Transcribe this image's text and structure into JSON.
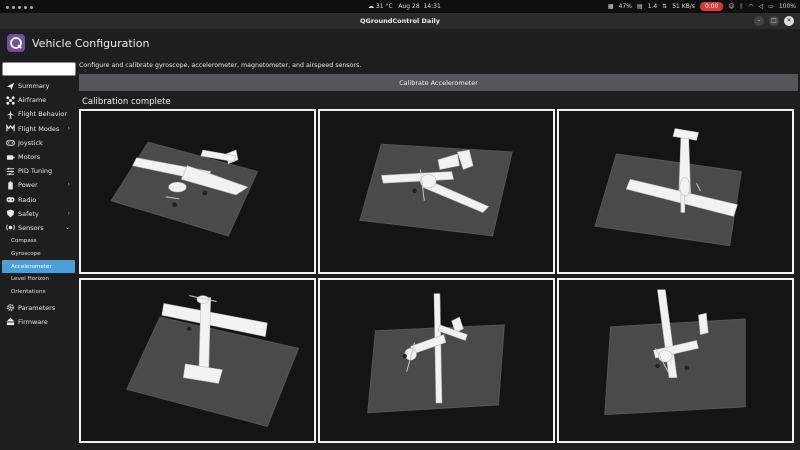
{
  "system_bar": {
    "temperature": "31 °C",
    "date": "Aug 28",
    "time": "14:31",
    "cpu": "47%",
    "load": "1.4",
    "network": "51 KB/s",
    "record": "0:00",
    "battery": "100%"
  },
  "window": {
    "title": "QGroundControl Daily"
  },
  "header": {
    "title": "Vehicle Configuration"
  },
  "sidebar": {
    "search_placeholder": "",
    "items": [
      {
        "label": "Summary",
        "icon": "send-icon"
      },
      {
        "label": "Airframe",
        "icon": "airframe-icon"
      },
      {
        "label": "Flight Behavior",
        "icon": "plane-icon"
      },
      {
        "label": "Flight Modes",
        "icon": "flight-modes-icon",
        "chevron": "›"
      },
      {
        "label": "Joystick",
        "icon": "joystick-icon"
      },
      {
        "label": "Motors",
        "icon": "motor-icon"
      },
      {
        "label": "PID Tuning",
        "icon": "tuning-icon"
      },
      {
        "label": "Power",
        "icon": "battery-icon",
        "chevron": "›"
      },
      {
        "label": "Radio",
        "icon": "radio-icon"
      },
      {
        "label": "Safety",
        "icon": "shield-icon",
        "chevron": "›"
      },
      {
        "label": "Sensors",
        "icon": "sensors-icon",
        "chevron": "⌄"
      },
      {
        "label": "Parameters",
        "icon": "gear-icon"
      },
      {
        "label": "Firmware",
        "icon": "firmware-icon"
      }
    ],
    "sensor_subitems": [
      "Compass",
      "Gyroscope",
      "Accelerometer",
      "Level Horizon",
      "Orientations"
    ],
    "active_subitem": "Accelerometer"
  },
  "main": {
    "description": "Configure and calibrate gyroscope, accelerometer, magnetometer, and airspeed sensors.",
    "calibrate_button": "Calibrate Accelerometer",
    "status": "Calibration complete",
    "orientations": [
      "level",
      "nose-down-left",
      "nose-up",
      "nose-down",
      "left-side",
      "right-side"
    ]
  },
  "colors": {
    "accent": "#4a9fd9",
    "record": "#d43a3a",
    "logo": "#6e4fa0",
    "button": "#56565a"
  }
}
